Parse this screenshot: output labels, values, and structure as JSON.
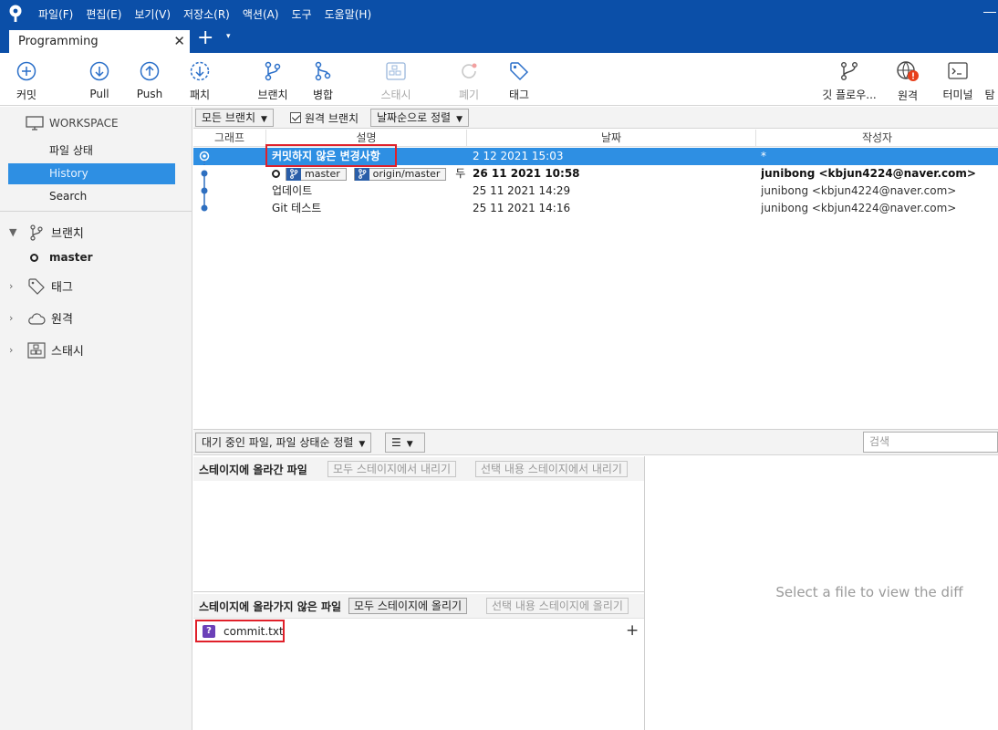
{
  "menu": [
    "파일(F)",
    "편집(E)",
    "보기(V)",
    "저장소(R)",
    "액션(A)",
    "도구",
    "도움말(H)"
  ],
  "tab": {
    "title": "Programming",
    "close": "✕",
    "add": "+",
    "dropdown": "▾"
  },
  "toolbar": {
    "commit": "커밋",
    "pull": "Pull",
    "push": "Push",
    "fetch": "패치",
    "branch": "브랜치",
    "merge": "병합",
    "stash": "스태시",
    "discard": "폐기",
    "tag": "태그",
    "gitflow": "깃 플로우...",
    "remote": "원격",
    "terminal": "터미널",
    "more": "탐"
  },
  "sidebar": {
    "workspace": "WORKSPACE",
    "links": [
      "파일 상태",
      "History",
      "Search"
    ],
    "active_link": "History",
    "branches_label": "브랜치",
    "current_branch": "master",
    "tags_label": "태그",
    "remotes_label": "원격",
    "stashes_label": "스태시"
  },
  "history_filter": {
    "branches": "모든 브랜치",
    "remote_branches": "원격 브랜치",
    "remote_branches_checked": true,
    "sort": "날짜순으로 정렬"
  },
  "columns": [
    "그래프",
    "설명",
    "날짜",
    "작성자"
  ],
  "commits": [
    {
      "description": "커밋하지 않은 변경사항",
      "date": "2 12 2021 15:03",
      "author": "*"
    },
    {
      "description": "",
      "tags": [
        "master",
        "origin/master"
      ],
      "trail": "두",
      "date": "26 11 2021 10:58",
      "author": "junibong <kbjun4224@naver.com>"
    },
    {
      "description": "업데이트",
      "date": "25 11 2021 14:29",
      "author": "junibong <kbjun4224@naver.com>"
    },
    {
      "description": "Git 테스트",
      "date": "25 11 2021 14:16",
      "author": "junibong <kbjun4224@naver.com>"
    }
  ],
  "files": {
    "sort": "대기 중인 파일, 파일 상태순 정렬",
    "view_icon": "☰",
    "search_placeholder": "검색",
    "staged_title": "스테이지에 올라간 파일",
    "unstage_all": "모두 스테이지에서 내리기",
    "unstage_selected": "선택 내용 스테이지에서 내리기",
    "unstaged_title": "스테이지에 올라가지 않은 파일",
    "stage_all": "모두 스테이지에 올리기",
    "stage_selected": "선택 내용 스테이지에 올리기",
    "unstaged_files": [
      {
        "name": "commit.txt",
        "status": "?"
      }
    ],
    "add_icon": "+"
  },
  "diff": {
    "placeholder": "Select a file to view the diff"
  },
  "colors": {
    "menubar": "#0b4fa8",
    "selection": "#2e8fe3",
    "highlight_box": "#e0202a",
    "untracked": "#6b40b8"
  }
}
